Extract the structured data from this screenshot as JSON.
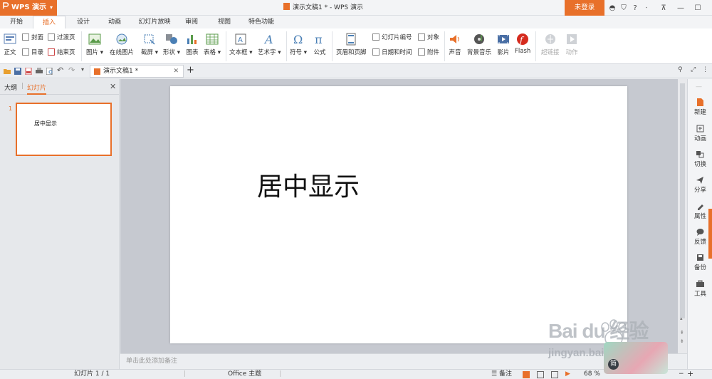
{
  "app": {
    "name": "WPS 演示",
    "doc_title": "演示文稿1 * - WPS 演示",
    "login_label": "未登录"
  },
  "tabs": [
    "开始",
    "插入",
    "设计",
    "动画",
    "幻灯片放映",
    "审阅",
    "视图",
    "特色功能"
  ],
  "ribbon": {
    "zhengwen": "正文",
    "fengmian": "封面",
    "mulu": "目录",
    "guoduye": "过渡页",
    "jieshuye": "结束页",
    "tupian": "图片",
    "zaixiantupian": "在线图片",
    "jieping": "截屏",
    "xingzhuang": "形状",
    "tubiao": "图表",
    "biaoge": "表格",
    "wenbenkuang": "文本框",
    "yishuzi": "艺术字",
    "fuhao": "符号",
    "gongshi": "公式",
    "yemei": "页眉和页脚",
    "bianhao": "幻灯片编号",
    "riqi": "日期和时间",
    "duixiang": "对象",
    "fujian": "附件",
    "shengyin": "声音",
    "beijingyinyue": "背景音乐",
    "yingpian": "影片",
    "flash": "Flash",
    "chaolianjie": "超链接",
    "dongzuo": "动作"
  },
  "doc_tab": "演示文稿1 *",
  "left_panel": {
    "outline_tab": "大纲",
    "slides_tab": "幻灯片",
    "slide_number": "1",
    "thumb_text": "居中显示"
  },
  "slide": {
    "text": "居中显示"
  },
  "notes_placeholder": "单击此处添加备注",
  "right_bar": [
    "新建",
    "动画",
    "切换",
    "分享",
    "属性",
    "反馈",
    "备份",
    "工具"
  ],
  "status": {
    "slide_count": "幻灯片 1 / 1",
    "theme": "Office 主题",
    "notes": "备注",
    "zoom": "68 %"
  },
  "watermark": {
    "logo": "Bai du 经验",
    "url": "jingyan.baidu.com",
    "badge": "简"
  },
  "colors": {
    "accent": "#e8702a"
  }
}
